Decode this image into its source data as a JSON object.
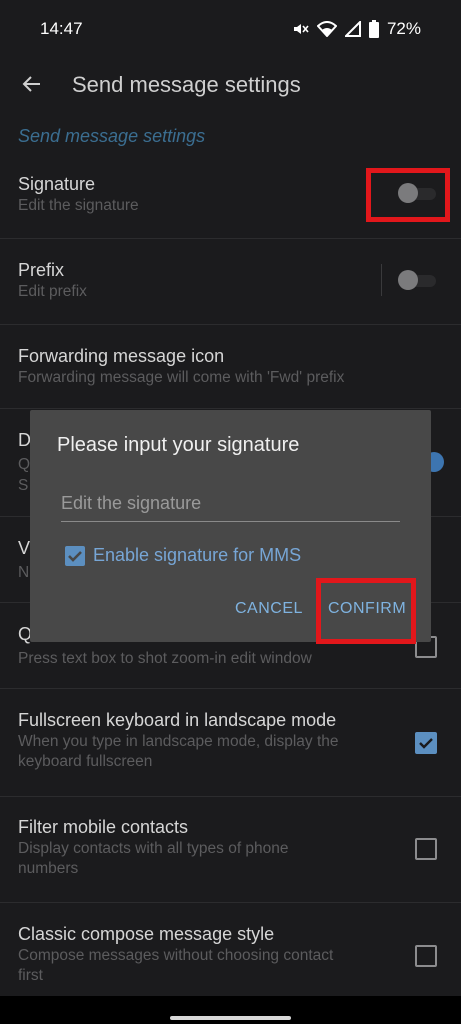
{
  "status_bar": {
    "time": "14:47",
    "battery": "72%",
    "icons": [
      "mute-icon",
      "wifi-icon",
      "signal-icon",
      "battery-icon"
    ]
  },
  "app_bar": {
    "title": "Send message settings"
  },
  "section_header": "Send message settings",
  "prefs": {
    "signature": {
      "title": "Signature",
      "summary": "Edit the signature"
    },
    "prefix": {
      "title": "Prefix",
      "summary": "Edit prefix"
    },
    "forwarding": {
      "title": "Forwarding message icon",
      "summary": "Forwarding message will come with 'Fwd' prefix"
    },
    "partial_d": {
      "title": "D",
      "summary_1": "Q",
      "summary_2": "S"
    },
    "partial_v": {
      "title": "V",
      "summary": "N"
    },
    "partial_q": {
      "title": "Q",
      "summary": "Press text box to shot zoom-in edit window"
    },
    "fullscreen": {
      "title": "Fullscreen keyboard in landscape mode",
      "summary_1": "When you type in landscape mode, display the",
      "summary_2": "keyboard fullscreen"
    },
    "filter": {
      "title": "Filter mobile contacts",
      "summary_1": "Display contacts with all types of phone",
      "summary_2": "numbers"
    },
    "classic": {
      "title": "Classic compose message style",
      "summary_1": "Compose messages without choosing contact",
      "summary_2": "first"
    }
  },
  "dialog": {
    "title": "Please input your signature",
    "input_placeholder": "Edit the signature",
    "checkbox_label": "Enable signature for MMS",
    "cancel_label": "CANCEL",
    "confirm_label": "CONFIRM"
  },
  "colors": {
    "background": "#1b1b1d",
    "accent": "#5c8fc0",
    "highlight": "#e2171b",
    "dialog_bg": "#484848"
  }
}
